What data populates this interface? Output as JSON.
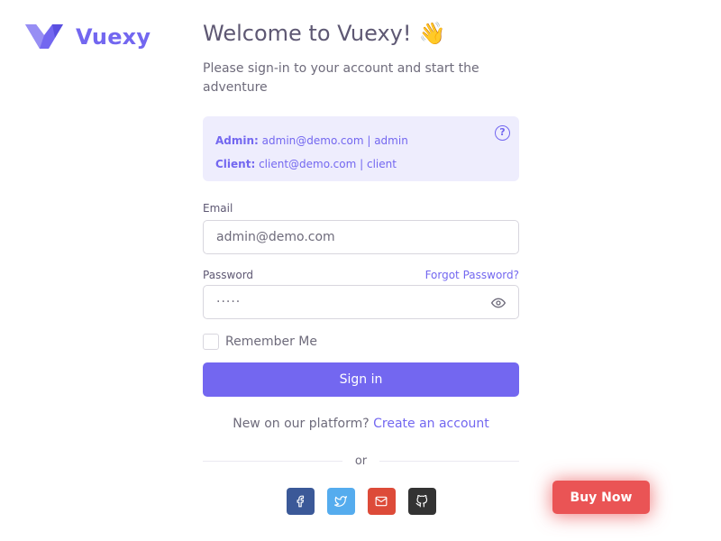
{
  "brand": {
    "name": "Vuexy",
    "logo_icon": "vuexy-logo-icon",
    "color": "#7367f0"
  },
  "header": {
    "title": "Welcome to Vuexy!",
    "title_emoji": "👋",
    "subtitle": "Please sign-in to your account and start the adventure"
  },
  "demo_alert": {
    "admin_label": "Admin:",
    "admin_value": "admin@demo.com | admin",
    "client_label": "Client:",
    "client_value": "client@demo.com | client",
    "help_icon": "help-circle-icon"
  },
  "form": {
    "email_label": "Email",
    "email_value": "admin@demo.com",
    "password_label": "Password",
    "forgot_link": "Forgot Password?",
    "password_value": "·····",
    "eye_icon": "eye-icon",
    "remember_label": "Remember Me",
    "remember_checked": false,
    "signin_label": "Sign in"
  },
  "footer": {
    "new_text": "New on our platform?",
    "create_link": "Create an account",
    "or_text": "or",
    "socials": [
      {
        "icon": "facebook-icon",
        "color": "#3b5998"
      },
      {
        "icon": "twitter-icon",
        "color": "#55acee"
      },
      {
        "icon": "mail-icon",
        "color": "#dd4b39"
      },
      {
        "icon": "github-icon",
        "color": "#333333"
      }
    ]
  },
  "buy_now": {
    "label": "Buy Now",
    "color": "#ea5455"
  },
  "colors": {
    "primary": "#7367f0",
    "heading": "#5e5873",
    "body": "#6e6b7b",
    "border": "#d8d6de"
  }
}
